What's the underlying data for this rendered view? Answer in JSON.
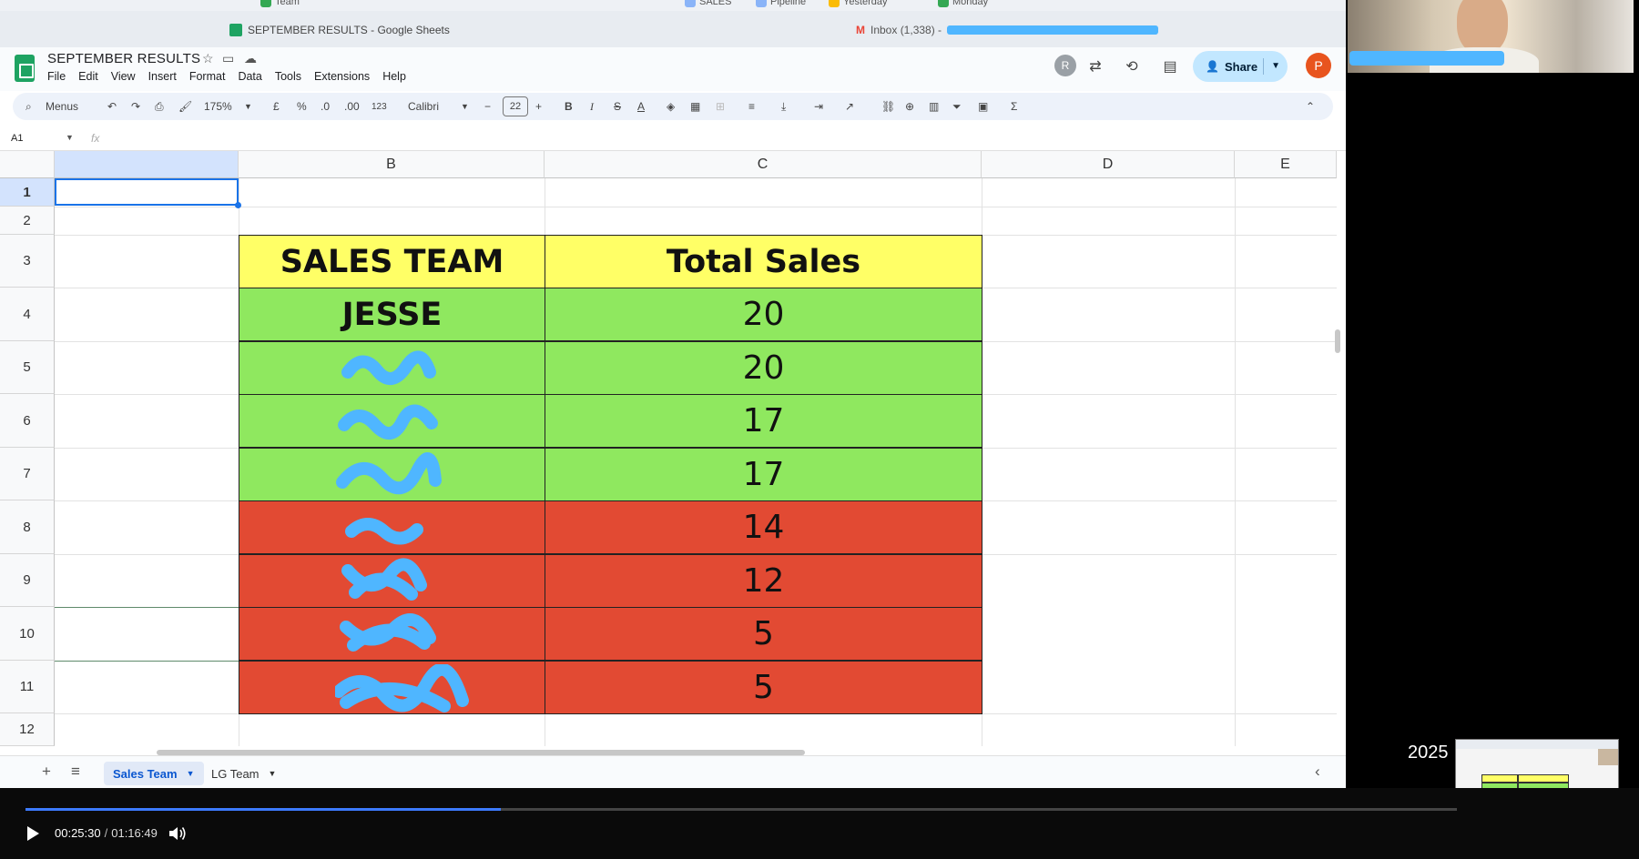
{
  "browser": {
    "bookmarks": [
      "Team",
      "SALES",
      "Pipeline",
      "Yesterday",
      "Monday"
    ],
    "tabs": [
      {
        "title": "SEPTEMBER RESULTS - Google Sheets"
      },
      {
        "title": "Inbox (1,338) -"
      }
    ]
  },
  "sheets": {
    "doc_title": "SEPTEMBER RESULTS",
    "menu": [
      "File",
      "Edit",
      "View",
      "Insert",
      "Format",
      "Data",
      "Tools",
      "Extensions",
      "Help"
    ],
    "share_label": "Share",
    "avatar_r": "R",
    "avatar_p": "P",
    "toolbar": {
      "menus_label": "Menus",
      "zoom": "175%",
      "currency": "£",
      "percent": "%",
      "dec_less": ".0",
      "dec_more": ".00",
      "number_format": "123",
      "font": "Calibri",
      "font_size": "22",
      "bold": "B",
      "italic": "I",
      "text_color": "A",
      "sum": "Σ"
    },
    "name_box": "A1",
    "fx": "fx",
    "columns": [
      "",
      "B",
      "C",
      "D",
      "E"
    ],
    "rows": [
      "1",
      "2",
      "3",
      "4",
      "5",
      "6",
      "7",
      "8",
      "9",
      "10",
      "11",
      "12"
    ],
    "table": {
      "header_team": "SALES TEAM",
      "header_sales": "Total Sales",
      "rows": [
        {
          "name": "JESSE",
          "sales": "20",
          "status": "green"
        },
        {
          "name": "",
          "sales": "20",
          "status": "green"
        },
        {
          "name": "",
          "sales": "17",
          "status": "green"
        },
        {
          "name": "",
          "sales": "17",
          "status": "green"
        },
        {
          "name": "",
          "sales": "14",
          "status": "red"
        },
        {
          "name": "",
          "sales": "12",
          "status": "red"
        },
        {
          "name": "",
          "sales": "5",
          "status": "red"
        },
        {
          "name": "",
          "sales": "5",
          "status": "red"
        }
      ]
    },
    "sheet_tabs": [
      {
        "label": "Sales Team",
        "active": true
      },
      {
        "label": "LG Team",
        "active": false
      }
    ]
  },
  "colors": {
    "header_yellow": "#ffff66",
    "green": "#8fe85f",
    "red": "#e24a33",
    "scribble": "#4fb6ff"
  },
  "overlay": {
    "year": "2025"
  },
  "player": {
    "current_time": "00:25:30",
    "separator": "/",
    "duration": "01:16:49",
    "progress": 0.332
  }
}
